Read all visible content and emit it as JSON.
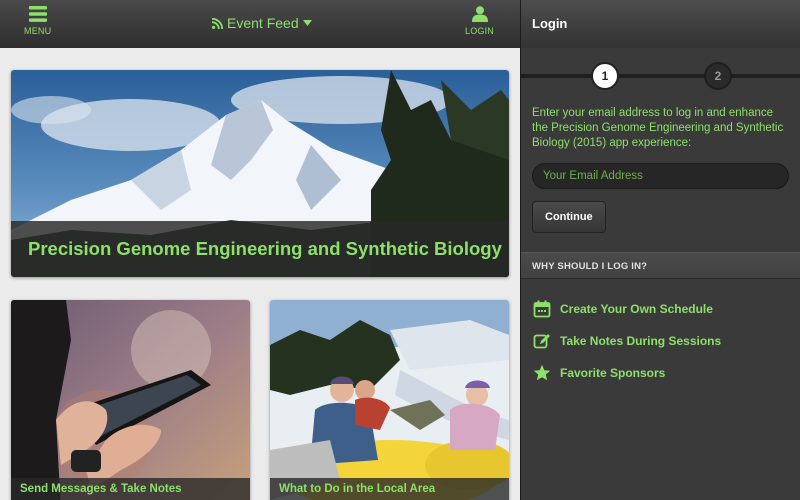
{
  "topbar": {
    "menu_label": "MENU",
    "menu_icon": "hamburger-icon",
    "feed_label": "Event Feed",
    "feed_icon": "rss-icon",
    "login_label": "LOGIN",
    "login_icon": "user-icon"
  },
  "hero": {
    "title": "Precision Genome Engineering and Synthetic Biology",
    "image": "snowy-mountain-photo"
  },
  "cards": [
    {
      "label": "Send Messages & Take Notes",
      "image": "tablet-hands-photo"
    },
    {
      "label": "What to Do in the Local Area",
      "image": "snow-tubing-photo"
    }
  ],
  "login_panel": {
    "title": "Login",
    "steps": [
      "1",
      "2"
    ],
    "active_step": 1,
    "intro": "Enter your email address to log in and enhance the Precision Genome Engineering and Synthetic Biology (2015) app experience:",
    "email_placeholder": "Your Email Address",
    "continue_label": "Continue",
    "why_heading": "WHY SHOULD I LOG IN?",
    "benefits": [
      {
        "label": "Create Your Own Schedule",
        "icon": "calendar-icon"
      },
      {
        "label": "Take Notes During Sessions",
        "icon": "pencil-icon"
      },
      {
        "label": "Favorite Sponsors",
        "icon": "star-icon"
      }
    ]
  },
  "colors": {
    "accent": "#8ee06a",
    "topbar": "#3a3a3a",
    "panel": "#3a3a3a",
    "page_bg": "#ebebeb"
  }
}
